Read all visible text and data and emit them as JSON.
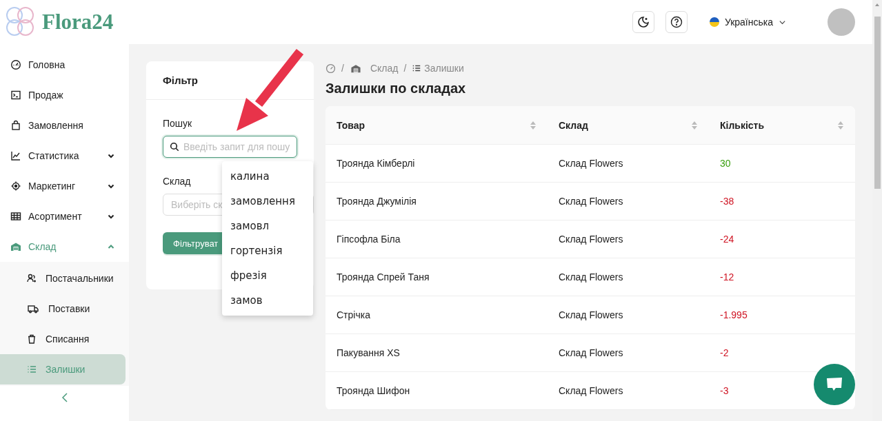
{
  "logo": {
    "text": "Flora24"
  },
  "header": {
    "language": "Українська"
  },
  "sidebar": {
    "items": [
      {
        "label": "Головна",
        "selected": false
      },
      {
        "label": "Продаж",
        "selected": false
      },
      {
        "label": "Замовлення",
        "selected": false
      },
      {
        "label": "Статистика",
        "selected": false,
        "expanded": false
      },
      {
        "label": "Маркетинг",
        "selected": false,
        "expanded": false
      },
      {
        "label": "Асортимент",
        "selected": false,
        "expanded": false
      },
      {
        "label": "Склад",
        "selected": false,
        "active": true,
        "expanded": true,
        "children": [
          {
            "label": "Постачальники",
            "selected": false
          },
          {
            "label": "Поставки",
            "selected": false
          },
          {
            "label": "Списання",
            "selected": false
          },
          {
            "label": "Залишки",
            "selected": true
          }
        ]
      }
    ]
  },
  "filter": {
    "title": "Фільтр",
    "search_label": "Пошук",
    "search_placeholder": "Введіть запит для пошу",
    "suggestions": [
      "калина",
      "замовлення",
      "замовл",
      "гортензія",
      "фрезія",
      "замов"
    ],
    "warehouse_label": "Склад",
    "warehouse_placeholder": "Виберіть ск",
    "button": "Фільтруват"
  },
  "breadcrumb": {
    "items": [
      "Склад",
      "Залишки"
    ],
    "separators": [
      "/",
      "/"
    ]
  },
  "page_title": "Залишки по складах",
  "table": {
    "columns": [
      "Товар",
      "Склад",
      "Кількість"
    ],
    "rows": [
      {
        "product": "Троянда Кімберлі",
        "warehouse": "Склад Flowers",
        "quantity": "30",
        "color": "#389e0d"
      },
      {
        "product": "Троянда Джумілія",
        "warehouse": "Склад Flowers",
        "quantity": "-38",
        "color": "#cf1322"
      },
      {
        "product": "Гіпсофла Біла",
        "warehouse": "Склад Flowers",
        "quantity": "-24",
        "color": "#cf1322"
      },
      {
        "product": "Троянда Спрей Таня",
        "warehouse": "Склад Flowers",
        "quantity": "-12",
        "color": "#cf1322"
      },
      {
        "product": "Стрічка",
        "warehouse": "Склад Flowers",
        "quantity": "-1.995",
        "color": "#cf1322"
      },
      {
        "product": "Пакування XS",
        "warehouse": "Склад Flowers",
        "quantity": "-2",
        "color": "#cf1322"
      },
      {
        "product": "Троянда Шифон",
        "warehouse": "Склад Flowers",
        "quantity": "-3",
        "color": "#cf1322"
      }
    ]
  }
}
